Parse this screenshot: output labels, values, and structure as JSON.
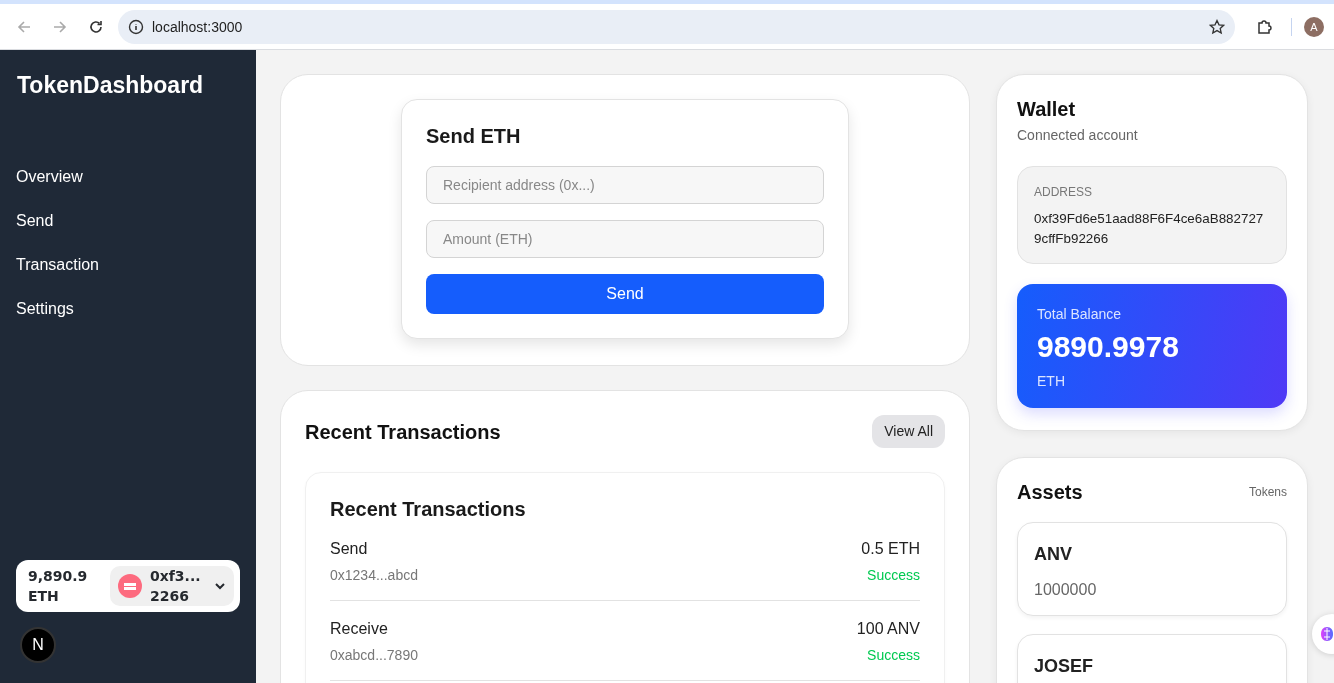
{
  "browser": {
    "url": "localhost:3000",
    "avatar": "A"
  },
  "sidebar": {
    "brand": "TokenDashboard",
    "items": [
      {
        "label": "Overview"
      },
      {
        "label": "Send"
      },
      {
        "label": "Transaction"
      },
      {
        "label": "Settings"
      }
    ],
    "connect": {
      "balance": "9,890.9 ETH",
      "account": "0xf3... 2266"
    },
    "dev_badge": "N"
  },
  "send": {
    "title": "Send ETH",
    "fields": [
      {
        "placeholder": "Recipient address (0x...)"
      },
      {
        "placeholder": "Amount (ETH)"
      }
    ],
    "button": "Send"
  },
  "transactions": {
    "title": "Recent Transactions",
    "view_all": "View All",
    "inner_title": "Recent Transactions",
    "rows": [
      {
        "type": "Send",
        "address": "0x1234...abcd",
        "amount": "0.5 ETH",
        "status": "Success",
        "kind": "success"
      },
      {
        "type": "Receive",
        "address": "0xabcd...7890",
        "amount": "100 ANV",
        "status": "Success",
        "kind": "success"
      }
    ]
  },
  "wallet": {
    "title": "Wallet",
    "subtitle": "Connected account",
    "address_label": "ADDRESS",
    "address": "0xf39Fd6e51aad88F6F4ce6aB8827279cffFb92266",
    "balance_label": "Total Balance",
    "balance": "9890.9978",
    "unit": "ETH"
  },
  "assets": {
    "title": "Assets",
    "tag": "Tokens",
    "items": [
      {
        "symbol": "ANV",
        "amount": "1000000"
      },
      {
        "symbol": "JOSEF"
      }
    ]
  }
}
